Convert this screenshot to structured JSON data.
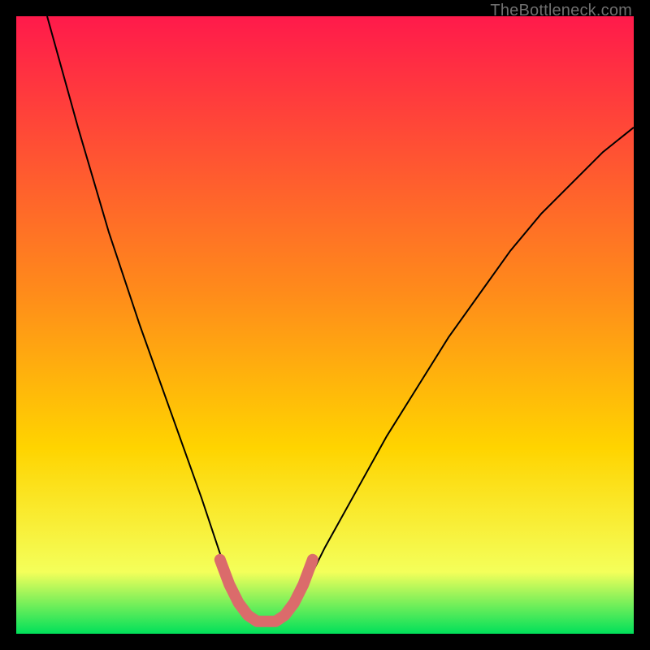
{
  "watermark": "TheBottleneck.com",
  "chart_data": {
    "type": "line",
    "title": "",
    "xlabel": "",
    "ylabel": "",
    "xlim": [
      0,
      100
    ],
    "ylim": [
      0,
      100
    ],
    "grid": false,
    "background_gradient": {
      "top": "#ff1a4b",
      "mid": "#ffd400",
      "bottom": "#00e05a"
    },
    "series": [
      {
        "name": "bottleneck-curve",
        "stroke": "#000000",
        "x": [
          5,
          10,
          15,
          20,
          25,
          30,
          32,
          34,
          36,
          38,
          40,
          42,
          44,
          46,
          50,
          55,
          60,
          65,
          70,
          75,
          80,
          85,
          90,
          95,
          100
        ],
        "y": [
          100,
          82,
          65,
          50,
          36,
          22,
          16,
          10,
          6,
          3,
          2,
          2,
          3,
          6,
          14,
          23,
          32,
          40,
          48,
          55,
          62,
          68,
          73,
          78,
          82
        ]
      },
      {
        "name": "sweet-spot-band",
        "stroke": "#db6b6b",
        "x": [
          33,
          34.5,
          36,
          37.5,
          39,
          40.5,
          42,
          43.5,
          45,
          46.5,
          48
        ],
        "y": [
          12,
          8,
          5,
          3,
          2,
          2,
          2,
          3,
          5,
          8,
          12
        ]
      }
    ],
    "annotations": []
  }
}
